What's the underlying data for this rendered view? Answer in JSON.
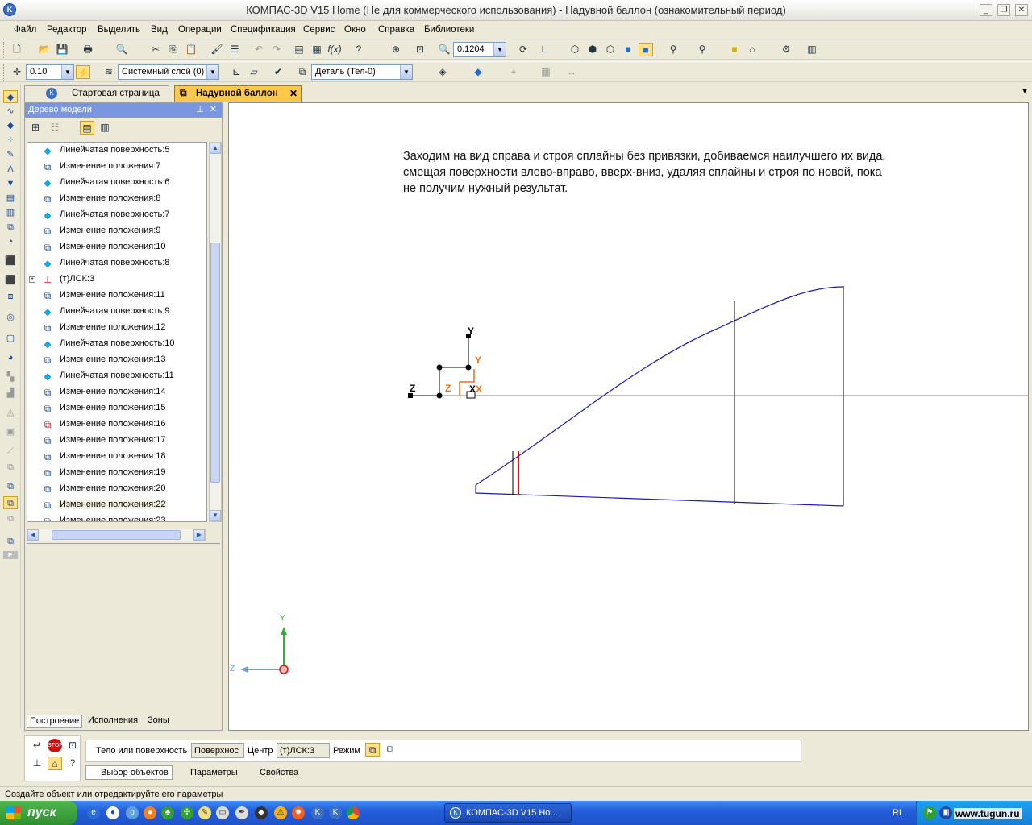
{
  "window": {
    "title": "КОМПАС-3D V15 Home (Не для коммерческого использования) - Надувной баллон (ознакомительный период)"
  },
  "menu": [
    "Файл",
    "Редактор",
    "Выделить",
    "Вид",
    "Операции",
    "Спецификация",
    "Сервис",
    "Окно",
    "Справка",
    "Библиотеки"
  ],
  "toolbar1": {
    "zoom_value": "0.1204"
  },
  "toolbar2": {
    "step_value": "0.10",
    "layer": "Системный слой (0)",
    "part": "Деталь (Тел-0)"
  },
  "tabs": [
    {
      "label": "Стартовая страница",
      "active": false
    },
    {
      "label": "Надувной баллон",
      "active": true
    }
  ],
  "tree": {
    "header": "Дерево модели",
    "items": [
      {
        "label": "Линейчатая поверхность:5",
        "icon": "ruled-surface-icon"
      },
      {
        "label": "Изменение положения:7",
        "icon": "move-icon"
      },
      {
        "label": "Линейчатая поверхность:6",
        "icon": "ruled-surface-icon"
      },
      {
        "label": "Изменение положения:8",
        "icon": "move-icon"
      },
      {
        "label": "Линейчатая поверхность:7",
        "icon": "ruled-surface-icon"
      },
      {
        "label": "Изменение положения:9",
        "icon": "move-icon"
      },
      {
        "label": "Изменение положения:10",
        "icon": "move-icon"
      },
      {
        "label": "Линейчатая поверхность:8",
        "icon": "ruled-surface-icon"
      },
      {
        "label": "(т)ЛСК:3",
        "icon": "lcs-icon"
      },
      {
        "label": "Изменение положения:11",
        "icon": "move-icon"
      },
      {
        "label": "Линейчатая поверхность:9",
        "icon": "ruled-surface-icon"
      },
      {
        "label": "Изменение положения:12",
        "icon": "move-icon"
      },
      {
        "label": "Линейчатая поверхность:10",
        "icon": "ruled-surface-icon"
      },
      {
        "label": "Изменение положения:13",
        "icon": "move-icon"
      },
      {
        "label": "Линейчатая поверхность:11",
        "icon": "ruled-surface-icon"
      },
      {
        "label": "Изменение положения:14",
        "icon": "move-icon"
      },
      {
        "label": "Изменение положения:15",
        "icon": "move-icon"
      },
      {
        "label": "Изменение положения:16",
        "icon": "move-error-icon"
      },
      {
        "label": "Изменение положения:17",
        "icon": "move-icon"
      },
      {
        "label": "Изменение положения:18",
        "icon": "move-icon"
      },
      {
        "label": "Изменение положения:19",
        "icon": "move-icon"
      },
      {
        "label": "Изменение положения:20",
        "icon": "move-icon"
      },
      {
        "label": "Изменение положения:22",
        "icon": "move-icon",
        "selected": true
      },
      {
        "label": "Изменение положения:23",
        "icon": "move-icon"
      }
    ],
    "bottom_tabs": [
      "Построение",
      "Исполнения",
      "Зоны"
    ]
  },
  "canvas": {
    "annotation_lines": [
      "Заходим на вид справа и строя сплайны без привязки, добиваемся наилучшего их вида,",
      "смещая поверхности влево-вправо, вверх-вниз, удаляя сплайны и строя по новой, пока",
      "не получим нужный результат."
    ],
    "axis_labels": {
      "y": "Y",
      "z": "Z",
      "x": "X"
    }
  },
  "properties": {
    "body_label": "Тело или поверхность",
    "body_value": "Поверхнос",
    "center_label": "Центр",
    "center_value": "(т)ЛСК:3",
    "mode_label": "Режим",
    "tabs": [
      "Выбор объектов",
      "Параметры",
      "Свойства"
    ]
  },
  "status": "Создайте объект или отредактируйте его параметры",
  "taskbar": {
    "start": "пуск",
    "task": "КОМПАС-3D V15 Ho...",
    "lang": "RL",
    "watermark": "www.tugun.ru"
  },
  "colors": {
    "spline": "#1a1ab8",
    "marker": "#e01010",
    "axis_orange": "#f07010",
    "axis_green": "#30b030"
  }
}
